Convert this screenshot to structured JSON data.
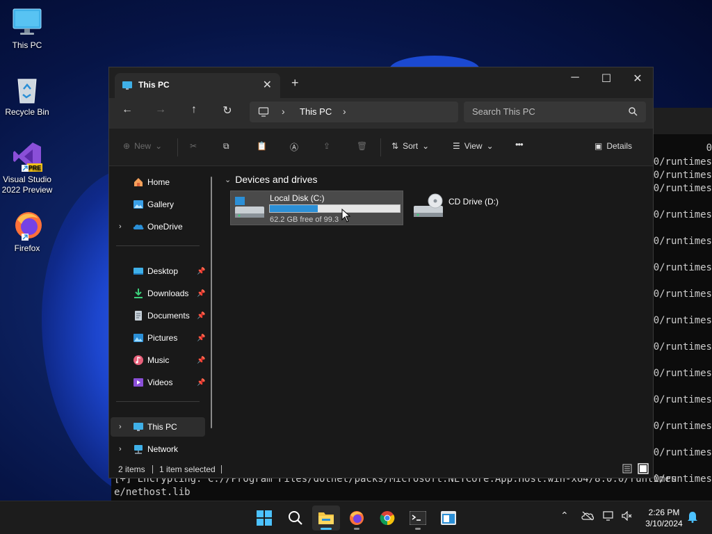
{
  "desktop": {
    "icons": [
      {
        "label": "This PC"
      },
      {
        "label": "Recycle Bin"
      },
      {
        "label": "Visual Studio 2022 Preview",
        "badge": "PRE"
      },
      {
        "label": "Firefox"
      }
    ]
  },
  "terminal": {
    "right_lines": [
      "0",
      "0/runtimes",
      "0/runtimes",
      "0/runtimes",
      "0/runtimes",
      "0/runtimes",
      "0/runtimes",
      "0/runtimes",
      "0/runtimes",
      "0/runtimes",
      "0/runtimes",
      "0/runtimes",
      "0/runtimes",
      "0/runtimes",
      "0/runtimes"
    ],
    "bottom_line1": "[+] Encrypting: C://Program Files/dotnet/packs/Microsoft.NETCore.App.Host.win-x64/8.0.0/runtimes",
    "bottom_line2": "e/nethost.lib"
  },
  "explorer": {
    "tab_title": "This PC",
    "address": "This PC",
    "search_placeholder": "Search This PC",
    "commands": {
      "new": "New",
      "sort": "Sort",
      "view": "View",
      "more": "•••",
      "details": "Details"
    },
    "sidebar": {
      "items": [
        {
          "label": "Home"
        },
        {
          "label": "Gallery"
        },
        {
          "label": "OneDrive"
        },
        {
          "label": "Desktop"
        },
        {
          "label": "Downloads"
        },
        {
          "label": "Documents"
        },
        {
          "label": "Pictures"
        },
        {
          "label": "Music"
        },
        {
          "label": "Videos"
        },
        {
          "label": "This PC"
        },
        {
          "label": "Network"
        }
      ]
    },
    "group_title": "Devices and drives",
    "drives": [
      {
        "name": "Local Disk (C:)",
        "free_text": "62.2 GB free of 99.3",
        "used_fraction": 0.37
      },
      {
        "name": "CD Drive (D:)"
      }
    ],
    "status": {
      "items": "2 items",
      "selected": "1 item selected"
    }
  },
  "taskbar": {
    "time": "2:26 PM",
    "date": "3/10/2024"
  },
  "colors": {
    "accent": "#4cc2ff",
    "drive_fill": "#2b8fd6",
    "window_bg": "#191919"
  }
}
